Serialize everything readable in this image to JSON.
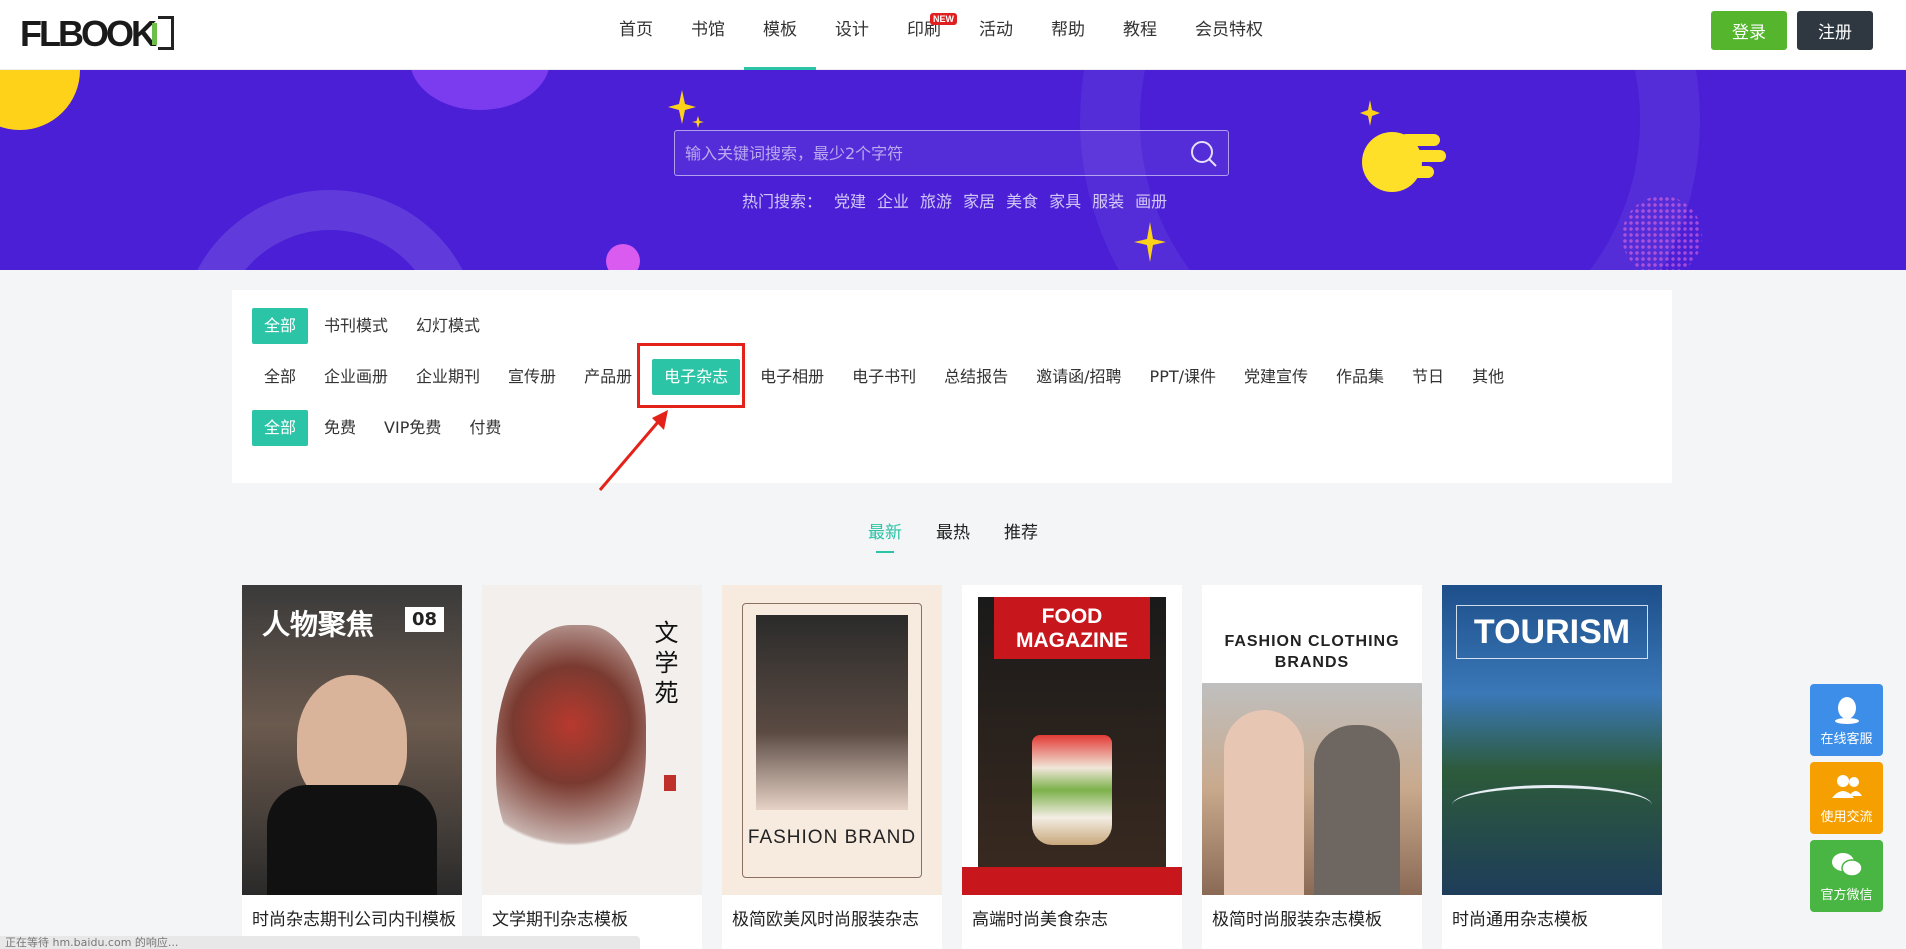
{
  "header": {
    "logo_text": "FLBOOK",
    "nav": [
      {
        "label": "首页"
      },
      {
        "label": "书馆"
      },
      {
        "label": "模板",
        "active": true
      },
      {
        "label": "设计"
      },
      {
        "label": "印刷",
        "badge": "NEW"
      },
      {
        "label": "活动"
      },
      {
        "label": "帮助"
      },
      {
        "label": "教程"
      },
      {
        "label": "会员特权"
      }
    ],
    "login_label": "登录",
    "register_label": "注册"
  },
  "banner": {
    "search_placeholder": "输入关键词搜索，最少2个字符",
    "hot_label": "热门搜索：",
    "hot_items": [
      "党建",
      "企业",
      "旅游",
      "家居",
      "美食",
      "家具",
      "服装",
      "画册"
    ]
  },
  "filters": {
    "mode": [
      "全部",
      "书刊模式",
      "幻灯模式"
    ],
    "category": [
      "全部",
      "企业画册",
      "企业期刊",
      "宣传册",
      "产品册",
      "电子杂志",
      "电子相册",
      "电子书刊",
      "总结报告",
      "邀请函/招聘",
      "PPT/课件",
      "党建宣传",
      "作品集",
      "节日",
      "其他"
    ],
    "price": [
      "全部",
      "免费",
      "VIP免费",
      "付费"
    ],
    "selected_mode": "全部",
    "selected_category": "电子杂志",
    "selected_price": "全部"
  },
  "sort_tabs": [
    "最新",
    "最热",
    "推荐"
  ],
  "cards": [
    {
      "title": "时尚杂志期刊公司内刊模板",
      "cover_text": "人物聚焦",
      "cover_number": "08"
    },
    {
      "title": "文学期刊杂志模板",
      "cover_text": "文学苑"
    },
    {
      "title": "极简欧美风时尚服装杂志",
      "cover_text": "FASHION BRAND"
    },
    {
      "title": "高端时尚美食杂志",
      "cover_text": "FOOD MAGAZINE"
    },
    {
      "title": "极简时尚服装杂志模板",
      "cover_text": "FASHION CLOTHING BRANDS"
    },
    {
      "title": "时尚通用杂志模板",
      "cover_text": "TOURISM"
    }
  ],
  "side": [
    {
      "label": "在线客服",
      "color": "#3d8ee8"
    },
    {
      "label": "使用交流",
      "color": "#f5a000"
    },
    {
      "label": "官方微信",
      "color": "#49b542"
    }
  ],
  "status_text": "正在等待 hm.baidu.com 的响应..."
}
